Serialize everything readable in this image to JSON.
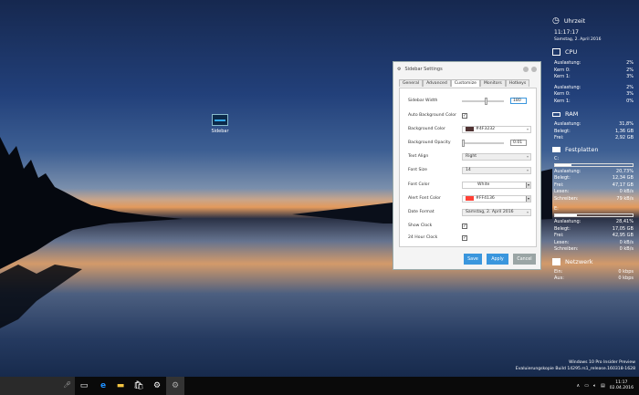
{
  "desktop": {
    "icon_label": "Sidebar"
  },
  "dialog": {
    "title": "Sidebar Settings",
    "tabs": [
      "General",
      "Advanced",
      "Customize",
      "Monitors",
      "Hotkeys"
    ],
    "labels": {
      "sidebar_width": "Sidebar Width",
      "auto_bg": "Auto Background Color",
      "bg_color": "Background Color",
      "bg_opacity": "Background Opacity",
      "text_align": "Text Align",
      "font_size": "Font Size",
      "font_color": "Font Color",
      "alert_color": "Alert Font Color",
      "date_format": "Date Format",
      "show_clock": "Show Clock",
      "clock24": "24 Hour Clock"
    },
    "values": {
      "sidebar_width": "180",
      "sidebar_width_fraction": 0.55,
      "bg_color": "#4F3232",
      "bg_opacity": "0.01",
      "bg_opacity_fraction": 0.01,
      "text_align": "Right",
      "font_size": "14",
      "font_color": "White",
      "alert_color": "#FF4136",
      "date_format": "Samstag, 2. April 2016",
      "auto_bg": true,
      "show_clock": true,
      "clock24": true
    },
    "buttons": {
      "save": "Save",
      "apply": "Apply",
      "cancel": "Cancel"
    }
  },
  "sidebar": {
    "clock": {
      "title": "Uhrzeit",
      "time": "11:17:17",
      "date": "Samstag, 2. April 2016"
    },
    "cpu": {
      "title": "CPU",
      "groups": [
        [
          [
            "Auslastung:",
            "2%"
          ],
          [
            "Kern 0:",
            "2%"
          ],
          [
            "Kern 1:",
            "3%"
          ]
        ],
        [
          [
            "Auslastung:",
            "2%"
          ],
          [
            "Kern 0:",
            "3%"
          ],
          [
            "Kern 1:",
            "0%"
          ]
        ]
      ]
    },
    "ram": {
      "title": "RAM",
      "rows": [
        [
          "Auslastung:",
          "31,8%"
        ],
        [
          "Belegt:",
          "1,36 GB"
        ],
        [
          "Frei:",
          "2,92 GB"
        ]
      ]
    },
    "disks": {
      "title": "Festplatten",
      "drives": [
        {
          "name": "C:",
          "usage": 0.2073,
          "rows": [
            [
              "Auslastung:",
              "20,73%"
            ],
            [
              "Belegt:",
              "12,34 GB"
            ],
            [
              "Frei:",
              "47,17 GB"
            ],
            [
              "Lesen:",
              "0 kB/s"
            ],
            [
              "Schreiben:",
              "79 kB/s"
            ]
          ]
        },
        {
          "name": "E:",
          "usage": 0.2841,
          "rows": [
            [
              "Auslastung:",
              "28,41%"
            ],
            [
              "Belegt:",
              "17,05 GB"
            ],
            [
              "Frei:",
              "42,95 GB"
            ],
            [
              "Lesen:",
              "0 kB/s"
            ],
            [
              "Schreiben:",
              "0 kB/s"
            ]
          ]
        }
      ]
    },
    "network": {
      "title": "Netzwerk",
      "rows": [
        [
          "Ein:",
          "0 kbps"
        ],
        [
          "Aus:",
          "0 kbps"
        ]
      ]
    }
  },
  "watermark": {
    "line1": "Windows 10 Pro Insider Preview",
    "line2": "Evaluierungskopie Build 14295.rs1_release.160318-1628"
  },
  "taskbar": {
    "time": "11:17",
    "date": "02.04.2016"
  },
  "colors": {
    "bg_swatch": "#4F3232",
    "alert_swatch": "#FF4136",
    "button": "#3a96dd"
  }
}
